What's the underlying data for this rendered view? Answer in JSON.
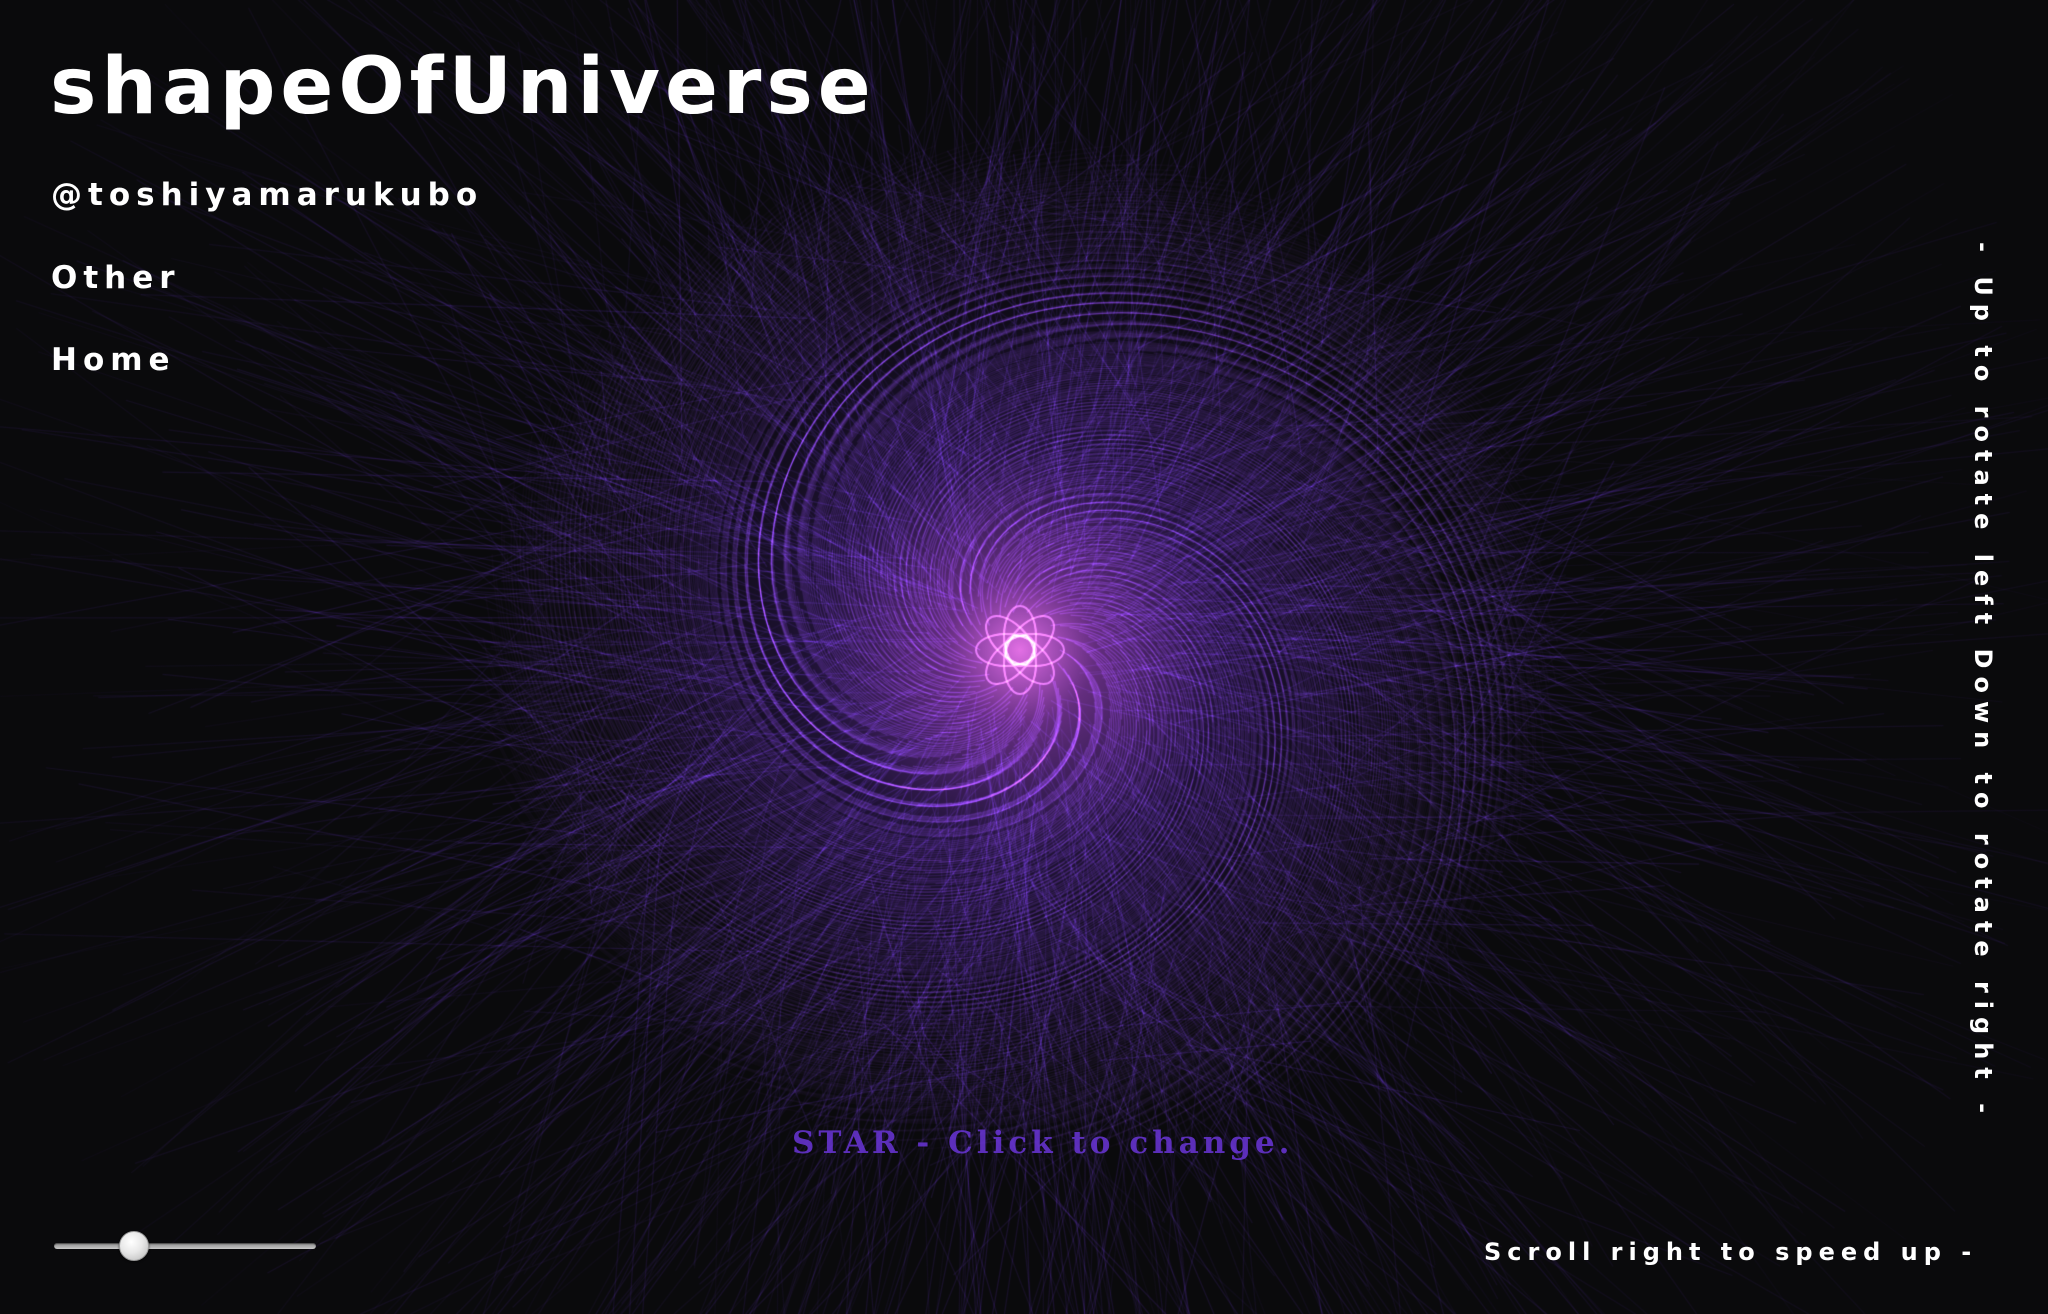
{
  "page": {
    "title": "shapeOfUniverse",
    "background_color": "#0a0a0c",
    "visual_accent": "#7a3cff",
    "visual_center_glow": "#ff7bff"
  },
  "nav": {
    "handle": "@toshiyamarukubo",
    "other": "Other",
    "home": "Home"
  },
  "canvas": {
    "shape_label": "STAR - Click to change.",
    "shape_label_color": "#6a36d8"
  },
  "hints": {
    "vertical": "- Up to rotate left    Down to rotate right -",
    "bottom": "Scroll right to speed up -"
  },
  "speed_slider": {
    "value_fraction": 0.3
  }
}
